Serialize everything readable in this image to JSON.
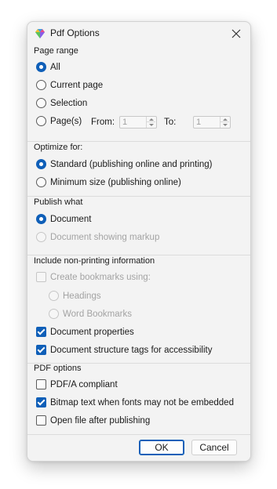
{
  "window": {
    "title": "Pdf Options",
    "icon": "gem-icon"
  },
  "page_range": {
    "label": "Page range",
    "options": [
      {
        "label": "All",
        "checked": true
      },
      {
        "label": "Current page",
        "checked": false
      },
      {
        "label": "Selection",
        "checked": false
      },
      {
        "label": "Page(s)",
        "checked": false
      }
    ],
    "from_label": "From:",
    "from_value": "1",
    "to_label": "To:",
    "to_value": "1"
  },
  "optimize_for": {
    "label": "Optimize for:",
    "options": [
      {
        "label": "Standard (publishing online and printing)",
        "checked": true
      },
      {
        "label": "Minimum size (publishing online)",
        "checked": false
      }
    ]
  },
  "publish_what": {
    "label": "Publish what",
    "options": [
      {
        "label": "Document",
        "checked": true,
        "enabled": true
      },
      {
        "label": "Document showing markup",
        "checked": false,
        "enabled": false
      }
    ]
  },
  "non_printing": {
    "label": "Include non-printing information",
    "create_bookmarks": {
      "label": "Create bookmarks using:",
      "checked": false,
      "enabled": false
    },
    "bookmark_options": [
      {
        "label": "Headings",
        "checked": false,
        "enabled": false
      },
      {
        "label": "Word Bookmarks",
        "checked": false,
        "enabled": false
      }
    ],
    "document_properties": {
      "label": "Document properties",
      "checked": true
    },
    "structure_tags": {
      "label": "Document structure tags for accessibility",
      "checked": true
    }
  },
  "pdf_options": {
    "label": "PDF options",
    "pdfa": {
      "label": "PDF/A compliant",
      "checked": false
    },
    "bitmap_text": {
      "label": "Bitmap text when fonts may not be embedded",
      "checked": true
    },
    "open_after": {
      "label": "Open file after publishing",
      "checked": false
    }
  },
  "buttons": {
    "ok": "OK",
    "cancel": "Cancel"
  },
  "colors": {
    "accent": "#0f5fb8",
    "dialog_bg": "#f3f3f3",
    "disabled_text": "#a3a3a3"
  }
}
